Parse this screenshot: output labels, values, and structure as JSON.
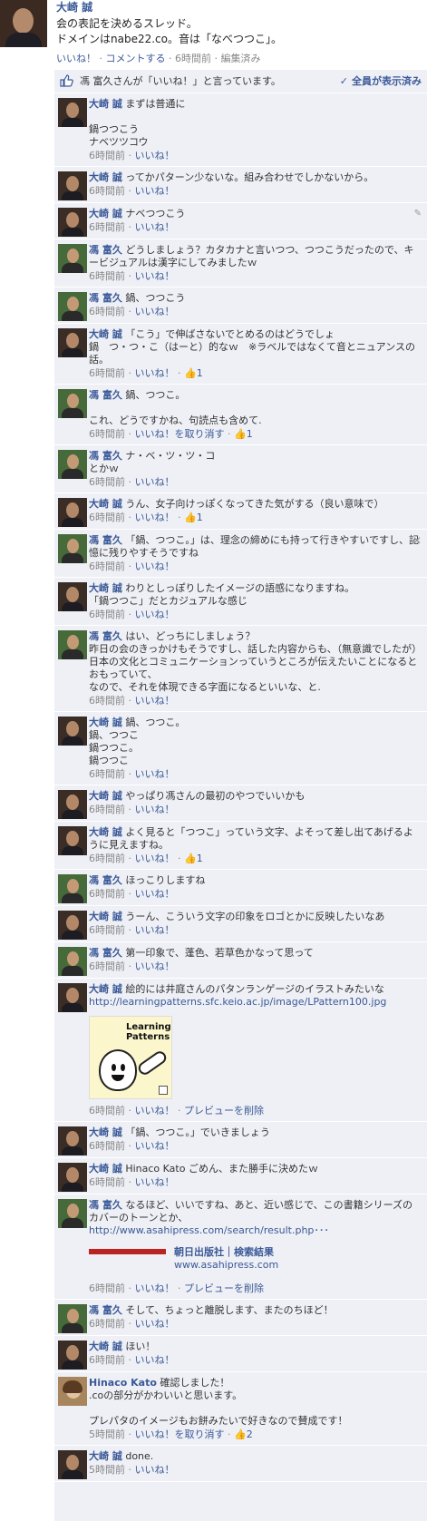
{
  "post": {
    "author": "大崎 誠",
    "body": "会の表記を決めるスレッド。\nドメインはnabe22.co。音は「なべつつこ」。",
    "like_label": "いいね！",
    "comment_label": "コメントする",
    "time": "6時間前",
    "edited": "編集済み",
    "sep": " · "
  },
  "likes": {
    "text": "馮 富久さんが「いいね！」と言っています。",
    "seen": "全員が表示済み"
  },
  "labels": {
    "like": "いいね！",
    "unlike": "いいね！を取り消す",
    "remove_preview": "プレビューを削除",
    "sep": " · "
  },
  "comments": [
    {
      "author": "大崎 誠",
      "avatar": "om",
      "text": "まずは普通に\n\n鍋つつこう\nナベツツコウ",
      "time": "6時間前"
    },
    {
      "author": "大崎 誠",
      "avatar": "om",
      "text": "ってかパターン少ないな。組み合わせでしかないから。",
      "time": "6時間前"
    },
    {
      "author": "大崎 誠",
      "avatar": "om",
      "text": "ナベつつこう",
      "time": "6時間前"
    },
    {
      "author": "馮 富久",
      "avatar": "fu",
      "text": "どうしましょう？カタカナと言いつつ、つつこうだったので、キービジュアルは漢字にしてみましたｗ",
      "time": "6時間前"
    },
    {
      "author": "馮 富久",
      "avatar": "fu",
      "text": "鍋、つつこう",
      "time": "6時間前"
    },
    {
      "author": "大崎 誠",
      "avatar": "om",
      "text": "「こう」で伸ばさないでとめるのはどうでしょ\n鍋　つ・つ・こ（はーと）的なｗ　※ラベルではなくて音とニュアンスの話。",
      "time": "6時間前",
      "likes": "1"
    },
    {
      "author": "馮 富久",
      "avatar": "fu",
      "text": "鍋、つつこ。\n\nこれ、どうですかね、句読点も含めて.",
      "time": "6時間前",
      "likes": "1",
      "liked": true
    },
    {
      "author": "馮 富久",
      "avatar": "fu",
      "text": "ナ・ベ・ツ・ツ・コ\nとかｗ",
      "time": "6時間前"
    },
    {
      "author": "大崎 誠",
      "avatar": "om",
      "text": "うん、女子向けっぽくなってきた気がする（良い意味で）",
      "time": "6時間前",
      "likes": "1"
    },
    {
      "author": "馮 富久",
      "avatar": "fu",
      "text": "「鍋、つつこ。」は、理念の締めにも持って行きやすいですし、記憶に残りやすそうですね",
      "time": "6時間前"
    },
    {
      "author": "大崎 誠",
      "avatar": "om",
      "text": "わりとしっぽりしたイメージの語感になりますね。\n「鍋つつこ」だとカジュアルな感じ",
      "time": "6時間前"
    },
    {
      "author": "馮 富久",
      "avatar": "fu",
      "text": "はい、どっちにしましょう？\n昨日の会のきっかけもそうですし、話した内容からも、（無意識でしたが）日本の文化とコミュニケーションっていうところが伝えたいことになるとおもっていて、\nなので、それを体現できる字面になるといいな、と.",
      "time": "6時間前"
    },
    {
      "author": "大崎 誠",
      "avatar": "om",
      "text": "鍋、つつこ。\n鍋、つつこ\n鍋つつこ。\n鍋つつこ",
      "time": "6時間前"
    },
    {
      "author": "大崎 誠",
      "avatar": "om",
      "text": "やっぱり馮さんの最初のやつでいいかも",
      "time": "6時間前"
    },
    {
      "author": "大崎 誠",
      "avatar": "om",
      "text": "よく見ると「つつこ」っていう文字、よそって差し出てあげるように見えますね。",
      "time": "6時間前",
      "likes": "1"
    },
    {
      "author": "馮 富久",
      "avatar": "fu",
      "text": "ほっこりしますね",
      "time": "6時間前"
    },
    {
      "author": "大崎 誠",
      "avatar": "om",
      "text": "うーん、こういう文字の印象をロゴとかに反映したいなあ",
      "time": "6時間前"
    },
    {
      "author": "馮 富久",
      "avatar": "fu",
      "text": "第一印象で、蓬色、若草色かなって思って",
      "time": "6時間前"
    },
    {
      "author": "大崎 誠",
      "avatar": "om",
      "text": "絵的には井庭さんのパタンランゲージのイラストみたいな",
      "url": "http://learningpatterns.sfc.keio.ac.jp/image/LPattern100.jpg",
      "image_caption": "Learning Patterns",
      "time": "6時間前",
      "preview": true
    },
    {
      "author": "大崎 誠",
      "avatar": "om",
      "text": "「鍋、つつこ。」でいきましょう",
      "time": "6時間前"
    },
    {
      "author": "大崎 誠",
      "avatar": "om",
      "text": "Hinaco Kato ごめん、また勝手に決めたｗ",
      "time": "6時間前"
    },
    {
      "author": "馮 富久",
      "avatar": "fu",
      "text": "なるほど、いいですね、あと、近い感じで、この書籍シリーズのカバーのトーンとか、",
      "url": "http://www.asahipress.com/search/result.php･･･",
      "link_title": "朝日出版社｜検索結果",
      "link_domain": "www.asahipress.com",
      "time": "6時間前",
      "preview": true
    },
    {
      "author": "馮 富久",
      "avatar": "fu",
      "text": "そして、ちょっと離脱します、またのちほど！",
      "time": "6時間前"
    },
    {
      "author": "大崎 誠",
      "avatar": "om",
      "text": "ほい！",
      "time": "6時間前"
    },
    {
      "author": "Hinaco Kato",
      "avatar": "hk",
      "text": "確認しました！\n.coの部分がかわいいと思います。\n\nプレパタのイメージもお餅みたいで好きなので賛成です！",
      "time": "5時間前",
      "likes": "2",
      "liked": true
    },
    {
      "author": "大崎 誠",
      "avatar": "om",
      "text": "done.",
      "time": "5時間前"
    }
  ]
}
